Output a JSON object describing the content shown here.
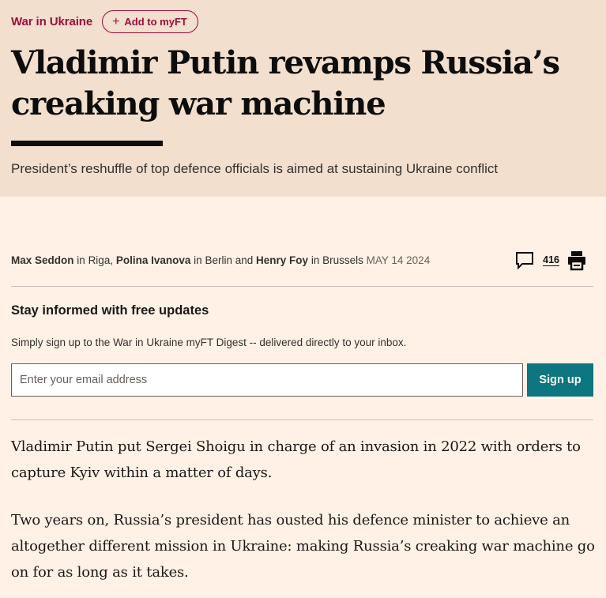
{
  "topic": {
    "label": "War in Ukraine",
    "myft_label": "Add to myFT"
  },
  "headline": "Vladimir Putin revamps Russia’s creaking war machine",
  "standfirst": "President’s reshuffle of top defence officials is aimed at sustaining Ukraine conflict",
  "byline": {
    "authors": [
      {
        "name": "Max Seddon",
        "location": "Riga"
      },
      {
        "name": "Polina Ivanova",
        "location": "Berlin"
      },
      {
        "name": "Henry Foy",
        "location": "Brussels"
      }
    ],
    "in_word": "in",
    "and_word": "and",
    "date": "MAY 14 2024"
  },
  "tools": {
    "comment_count": "416",
    "icons": [
      "comment-icon",
      "print-icon"
    ]
  },
  "signup": {
    "title": "Stay informed with free updates",
    "description": "Simply sign up to the War in Ukraine myFT Digest -- delivered directly to your inbox.",
    "email_placeholder": "Enter your email address",
    "button_label": "Sign up"
  },
  "article": {
    "paragraphs": [
      "Vladimir Putin put Sergei Shoigu in charge of an invasion in 2022 with orders to capture Kyiv within a matter of days.",
      "Two years on, Russia’s president has ousted his defence minister to achieve an altogether different mission in Ukraine: making Russia’s creaking war machine go on for as long as it takes."
    ]
  },
  "colors": {
    "page_background": "#fff1e5",
    "hero_background": "#f2dfce",
    "claret": "#990f3d",
    "teal_button": "#0d7680"
  }
}
